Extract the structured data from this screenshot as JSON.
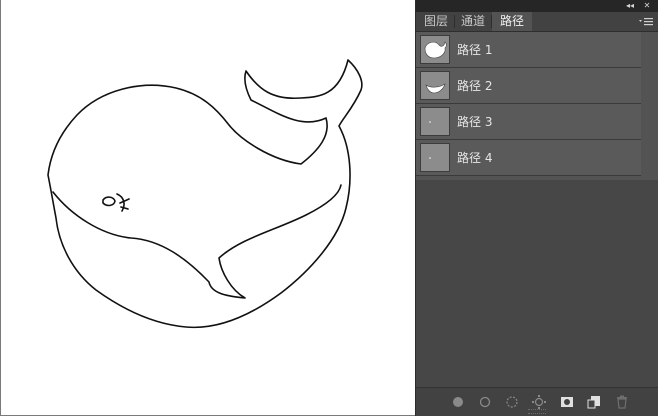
{
  "panel": {
    "titlebar": {
      "collapse_icon": "double-chevron-left-icon",
      "close_icon": "close-icon",
      "collapse_glyph": "◂◂",
      "close_glyph": "✕"
    },
    "tabs": [
      {
        "label": "图层",
        "active": false
      },
      {
        "label": "通道",
        "active": false
      },
      {
        "label": "路径",
        "active": true
      }
    ],
    "menu_icon": "panel-menu-icon",
    "paths": [
      {
        "label": "路径 1"
      },
      {
        "label": "路径 2"
      },
      {
        "label": "路径 3"
      },
      {
        "label": "路径 4"
      }
    ],
    "bottom_buttons": [
      "fill-path-icon",
      "stroke-path-icon",
      "load-selection-icon",
      "make-work-path-icon",
      "add-mask-icon",
      "new-path-icon",
      "trash-icon"
    ]
  }
}
